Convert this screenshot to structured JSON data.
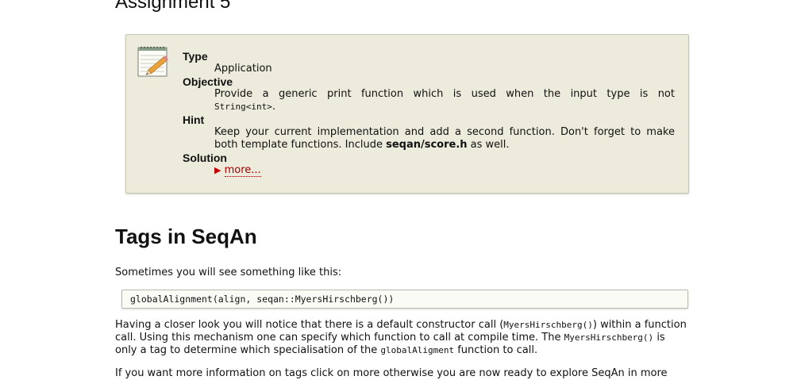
{
  "assignment": {
    "title": "Assignment 5",
    "type_label": "Type",
    "type_value": "Application",
    "objective_label": "Objective",
    "objective_text": "Provide a generic print function which is used when the input type is not",
    "objective_code": "String<int>",
    "objective_end": ".",
    "hint_label": "Hint",
    "hint_text1": "Keep your current implementation and add a second function. Don't forget to make",
    "hint_text2": "both template functions. Include ",
    "hint_bold": "seqan/score.h",
    "hint_text3": " as well.",
    "solution_label": "Solution",
    "solution_link": "more..."
  },
  "tags_section": {
    "heading": "Tags in SeqAn",
    "intro": "Sometimes you will see something like this:",
    "code": "globalAlignment(align, seqan::MyersHirschberg())",
    "p2_a": "Having a closer look you will notice that there is a default constructor call (",
    "p2_code1": "MyersHirschberg()",
    "p2_b": ") within a function call. Using this mechanism one can specify which function to call at compile time. The ",
    "p2_code2": "MyersHirschberg()",
    "p2_c": " is only a tag to determine which specialisation of the ",
    "p2_code3": "globalAligment",
    "p2_d": " function to call.",
    "p3": "If you want more information on tags click on more otherwise you are now ready to explore SeqAn in more"
  },
  "icons": {
    "notepad": "notepad-pencil-icon",
    "disclosure": "triangle-right-icon"
  },
  "colors": {
    "box_bg": "#ecebdc",
    "link": "#a00000"
  }
}
